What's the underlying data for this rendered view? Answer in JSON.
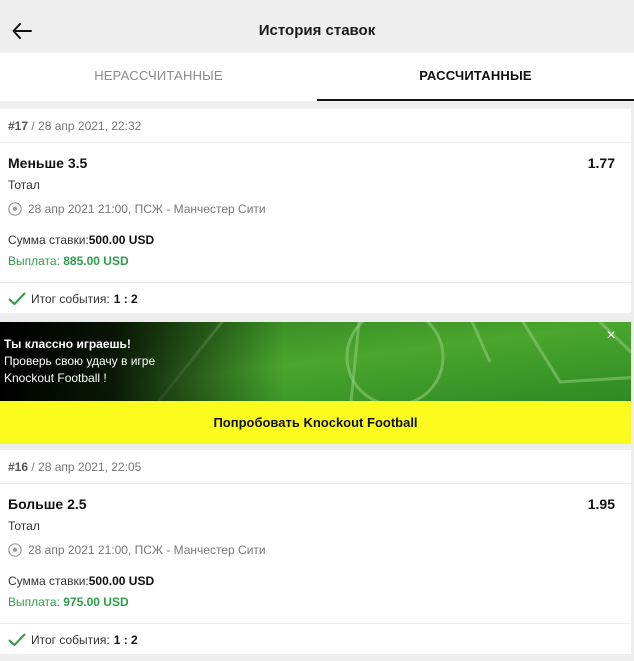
{
  "header": {
    "title": "История ставок"
  },
  "tabs": [
    {
      "label": "НЕРАССЧИТАННЫЕ"
    },
    {
      "label": "РАССЧИТАННЫЕ"
    }
  ],
  "bets": [
    {
      "number": "#17",
      "date": " / 28 апр 2021, 22:32",
      "selection": "Меньше 3.5",
      "odds": "1.77",
      "market": "Тотал",
      "event": "28 апр 2021 21:00, ПСЖ - Манчестер Сити",
      "stake_label": "Сумма ставки:",
      "stake_value": "500.00 USD",
      "payout_label": "Выплата: ",
      "payout_value": "885.00 USD",
      "result_label": "Итог события:",
      "result_value": "1 : 2"
    },
    {
      "number": "#16",
      "date": " / 28 апр 2021, 22:05",
      "selection": "Больше 2.5",
      "odds": "1.95",
      "market": "Тотал",
      "event": "28 апр 2021 21:00, ПСЖ - Манчестер Сити",
      "stake_label": "Сумма ставки:",
      "stake_value": "500.00 USD",
      "payout_label": "Выплата: ",
      "payout_value": "975.00 USD",
      "result_label": "Итог события:",
      "result_value": "1 : 2"
    }
  ],
  "promo": {
    "line1": "Ты классно играешь!",
    "line2": "Проверь свою удачу в игре",
    "line3": "Knockout Football !",
    "close_glyph": "×",
    "button_label": "Попробовать Knockout Football"
  },
  "colors": {
    "payout_green": "#2d9c4a",
    "promo_yellow": "#fbfb1e",
    "pitch_green": "#3f9a2a"
  },
  "icons": {
    "back": "arrow-left-icon",
    "sport": "soccer-ball-icon",
    "result": "check-icon",
    "close": "close-icon"
  }
}
